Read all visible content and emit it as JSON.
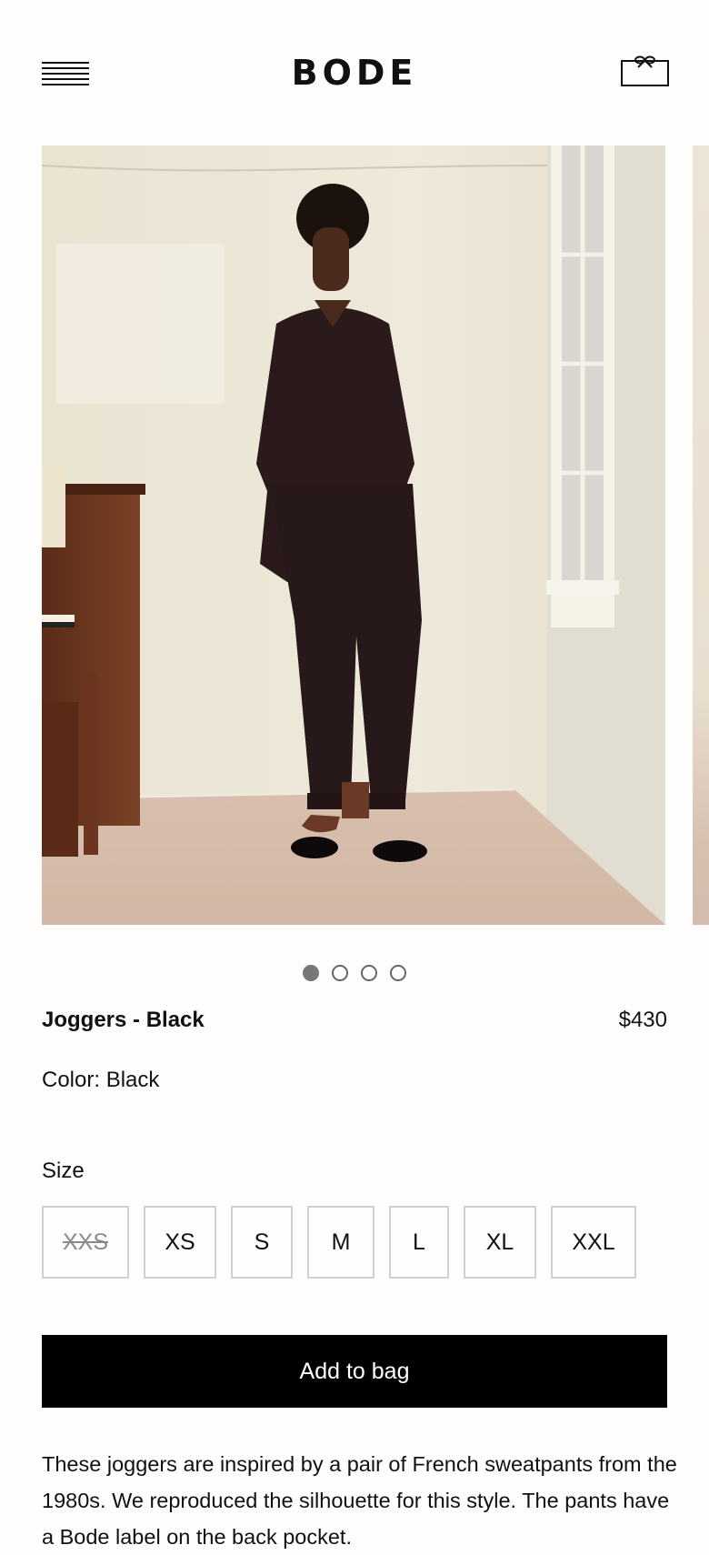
{
  "header": {
    "logo": "BODE",
    "menu_icon": "hamburger-menu-icon",
    "bag_icon": "shopping-bag-icon"
  },
  "gallery": {
    "image_count": 4,
    "active_index": 1,
    "main_image": "photo-man-in-black-sweatshirt-and-joggers",
    "next_image": "photo-next-slide-peek"
  },
  "product": {
    "name": "Joggers - Black",
    "price": "$430",
    "color_line": "Color: Black"
  },
  "size": {
    "label": "Size",
    "options": [
      {
        "label": "XXS",
        "available": false
      },
      {
        "label": "XS",
        "available": true
      },
      {
        "label": "S",
        "available": true
      },
      {
        "label": "M",
        "available": true
      },
      {
        "label": "L",
        "available": true
      },
      {
        "label": "XL",
        "available": true
      },
      {
        "label": "XXL",
        "available": true
      }
    ]
  },
  "actions": {
    "add_to_bag": "Add to bag"
  },
  "description": "These joggers are inspired by a pair of French sweatpants from the 1980s. We reproduced the silhouette for this style. The pants have a Bode label on the back pocket.",
  "colors": {
    "button_bg": "#000000",
    "button_text": "#ffffff",
    "disabled_size": "#8a8a8a",
    "dot_active": "#777777"
  }
}
